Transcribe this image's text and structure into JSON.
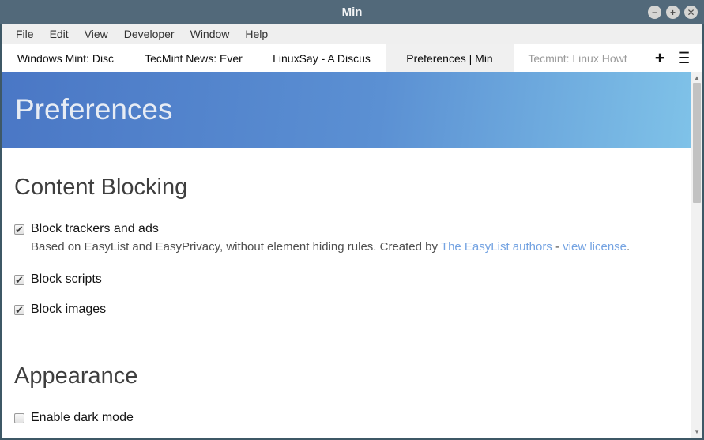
{
  "colors": {
    "titlebar": "#52697a",
    "window_border": "#3e5866",
    "menubar_bg": "#efefef",
    "active_tab_bg": "#f0f0f0",
    "muted_tab": "#9a9a9a",
    "header_grad_start": "#4a77c5",
    "header_grad_end": "#7fc2e8",
    "link": "#74a3e2"
  },
  "icons": {
    "minimize": "−",
    "maximize": "+",
    "close": "✕",
    "new_tab": "+",
    "menu": "☰",
    "scroll_up": "▲",
    "scroll_down": "▼",
    "checkmark": "✔"
  },
  "window": {
    "title": "Min"
  },
  "menu_bar": {
    "items": [
      {
        "label": "File"
      },
      {
        "label": "Edit"
      },
      {
        "label": "View"
      },
      {
        "label": "Developer"
      },
      {
        "label": "Window"
      },
      {
        "label": "Help"
      }
    ]
  },
  "tab_bar": {
    "tabs": [
      {
        "label": "Windows Mint: Disc",
        "active": false
      },
      {
        "label": "TecMint News: Ever",
        "active": false
      },
      {
        "label": "LinuxSay - A Discus",
        "active": false
      },
      {
        "label": "Preferences | Min",
        "active": true
      },
      {
        "label": "Tecmint: Linux Howt",
        "active": false
      }
    ]
  },
  "page": {
    "title": "Preferences",
    "sections": [
      {
        "heading": "Content Blocking",
        "settings": [
          {
            "label": "Block trackers and ads",
            "checked": true,
            "description": {
              "text": "Based on EasyList and EasyPrivacy, without element hiding rules. Created by ",
              "link1": "The EasyList authors",
              "separator": " - ",
              "link2": "view license",
              "end": "."
            }
          },
          {
            "label": "Block scripts",
            "checked": true
          },
          {
            "label": "Block images",
            "checked": true
          }
        ]
      },
      {
        "heading": "Appearance",
        "settings": [
          {
            "label": "Enable dark mode",
            "checked": false
          }
        ]
      }
    ]
  }
}
